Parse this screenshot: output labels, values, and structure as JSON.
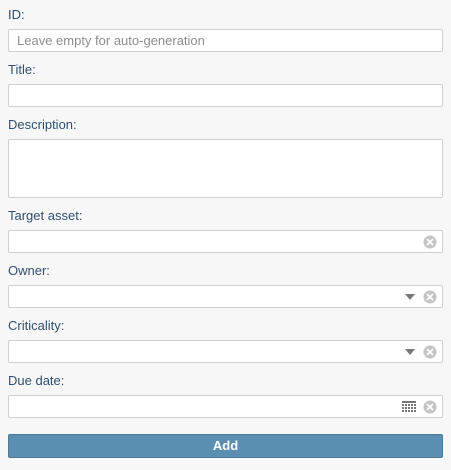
{
  "form": {
    "id": {
      "label": "ID:",
      "value": "",
      "placeholder": "Leave empty for auto-generation"
    },
    "title": {
      "label": "Title:",
      "value": ""
    },
    "description": {
      "label": "Description:",
      "value": ""
    },
    "target_asset": {
      "label": "Target asset:",
      "value": ""
    },
    "owner": {
      "label": "Owner:",
      "value": ""
    },
    "criticality": {
      "label": "Criticality:",
      "value": ""
    },
    "due_date": {
      "label": "Due date:",
      "value": ""
    },
    "add_label": "Add"
  },
  "icons": {
    "clear": "clear-icon",
    "dropdown": "chevron-down-icon",
    "calendar": "calendar-icon"
  },
  "colors": {
    "background": "#f7f7f7",
    "label_text": "#2f4f6e",
    "button_bg": "#5b8fb2",
    "input_border": "#cfcfcf"
  }
}
